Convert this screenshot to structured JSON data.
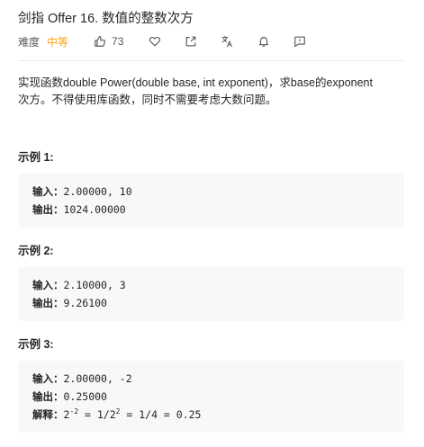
{
  "problem": {
    "title": "剑指 Offer 16. 数值的整数次方",
    "difficulty_label": "难度",
    "difficulty": "中等",
    "likes": "73",
    "description": [
      "实现函数double Power(double base, int exponent)，求base的exponent",
      "次方。不得使用库函数，同时不需要考虑大数问题。"
    ]
  },
  "examples": [
    {
      "label": "示例 1:",
      "input_key": "输入：",
      "input_value": "2.00000, 10",
      "output_key": "输出：",
      "output_value": "1024.00000"
    },
    {
      "label": "示例 2:",
      "input_key": "输入：",
      "input_value": "2.10000, 3",
      "output_key": "输出：",
      "output_value": "9.26100"
    },
    {
      "label": "示例 3:",
      "input_key": "输入：",
      "input_value": "2.00000, -2",
      "output_key": "输出：",
      "output_value": "0.25000",
      "explain_key": "解释：",
      "explain_base1": "2",
      "explain_exp1": "-2",
      "explain_mid": " = 1/2",
      "explain_exp2": "2",
      "explain_end": " = 1/4 = 0.25"
    }
  ],
  "icons": {
    "like": "thumbs-up-icon",
    "favorite": "heart-icon",
    "share": "share-icon",
    "translate": "translate-icon",
    "notify": "bell-icon",
    "feedback": "feedback-icon"
  },
  "colors": {
    "difficulty": "#ffa116",
    "code_background": "#f7f8fa",
    "text": "#262626"
  }
}
